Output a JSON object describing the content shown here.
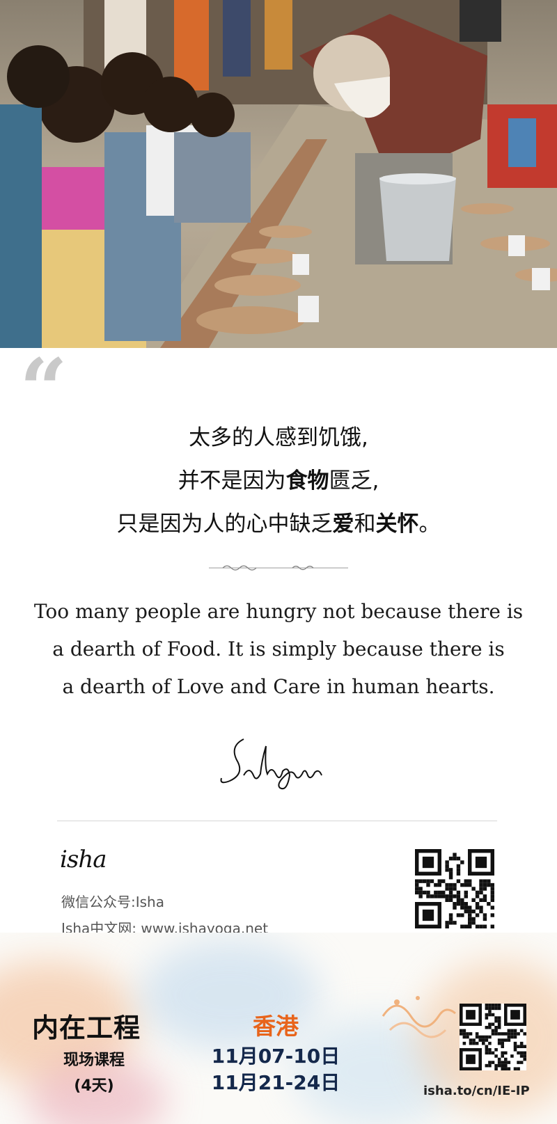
{
  "photo": {
    "description_icon": "community-meal-photo-icon"
  },
  "quote": {
    "mark": "“",
    "cn_lines": [
      [
        {
          "t": "太多的人感到饥饿,",
          "b": false
        }
      ],
      [
        {
          "t": "并不是因为",
          "b": false
        },
        {
          "t": "食物",
          "b": true
        },
        {
          "t": "匮乏,",
          "b": false
        }
      ],
      [
        {
          "t": "只是因为人的心中缺乏",
          "b": false
        },
        {
          "t": "爱",
          "b": true
        },
        {
          "t": "和",
          "b": false
        },
        {
          "t": "关怀",
          "b": true
        },
        {
          "t": "。",
          "b": false
        }
      ]
    ],
    "en_lines": [
      "Too many people are hungry not because there is",
      "a dearth of Food. It is simply because there is",
      "a dearth of Love and Care in human hearts."
    ],
    "signature": "Sadhguru"
  },
  "contact": {
    "logo": "isha",
    "wechat": "微信公众号:Isha",
    "site": "Isha中文网: www.ishayoga.net"
  },
  "banner": {
    "course_title": "内在工程",
    "course_sub_1": "现场课程",
    "course_sub_2": "(4天)",
    "city": "香港",
    "date_1": "11月07-10日",
    "date_2": "11月21-24日",
    "url": "isha.to/cn/IE-IP"
  },
  "colors": {
    "city": "#e8641b",
    "dates": "#14284b",
    "quote_mark": "#c9c9c9"
  }
}
